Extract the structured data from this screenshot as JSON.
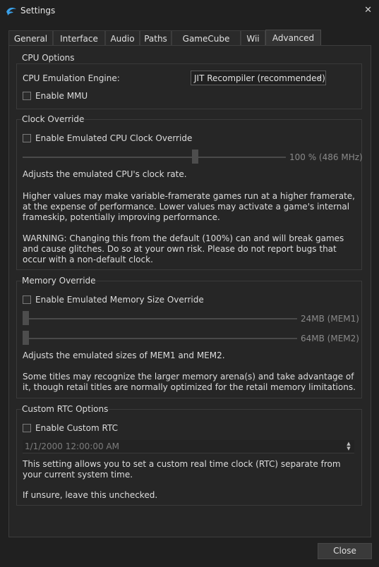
{
  "window": {
    "title": "Settings",
    "close_glyph": "✕"
  },
  "tabs": [
    {
      "label": "General"
    },
    {
      "label": "Interface"
    },
    {
      "label": "Audio"
    },
    {
      "label": "Paths"
    },
    {
      "label": "GameCube"
    },
    {
      "label": "Wii"
    },
    {
      "label": "Advanced",
      "active": true
    }
  ],
  "cpu_options": {
    "title": "CPU Options",
    "engine_label": "CPU Emulation Engine:",
    "engine_value": "JIT Recompiler (recommended)",
    "mmu_label": "Enable MMU",
    "mmu_checked": false
  },
  "clock_override": {
    "title": "Clock Override",
    "enable_label": "Enable Emulated CPU Clock Override",
    "enable_checked": false,
    "slider_value_text": "100 % (486 MHz)",
    "slider_fraction": 0.66,
    "desc1": "Adjusts the emulated CPU's clock rate.",
    "desc2": "Higher values may make variable-framerate games run at a higher framerate, at the expense of performance. Lower values may activate a game's internal frameskip, potentially improving performance.",
    "desc3": "WARNING: Changing this from the default (100%) can and will break games and cause glitches. Do so at your own risk. Please do not report bugs that occur with a non-default clock."
  },
  "memory_override": {
    "title": "Memory Override",
    "enable_label": "Enable Emulated Memory Size Override",
    "enable_checked": false,
    "mem1_text": "24MB (MEM1)",
    "mem1_fraction": 0.0,
    "mem2_text": "64MB (MEM2)",
    "mem2_fraction": 0.0,
    "desc1": "Adjusts the emulated sizes of MEM1 and MEM2.",
    "desc2": "Some titles may recognize the larger memory arena(s) and take advantage of it, though retail titles are normally optimized for the retail memory limitations."
  },
  "custom_rtc": {
    "title": "Custom RTC Options",
    "enable_label": "Enable Custom RTC",
    "enable_checked": false,
    "datetime_value": "1/1/2000 12:00:00 AM",
    "desc1": "This setting allows you to set a custom real time clock (RTC) separate from your current system time.",
    "desc2": "If unsure, leave this unchecked."
  },
  "footer": {
    "close_label": "Close"
  }
}
